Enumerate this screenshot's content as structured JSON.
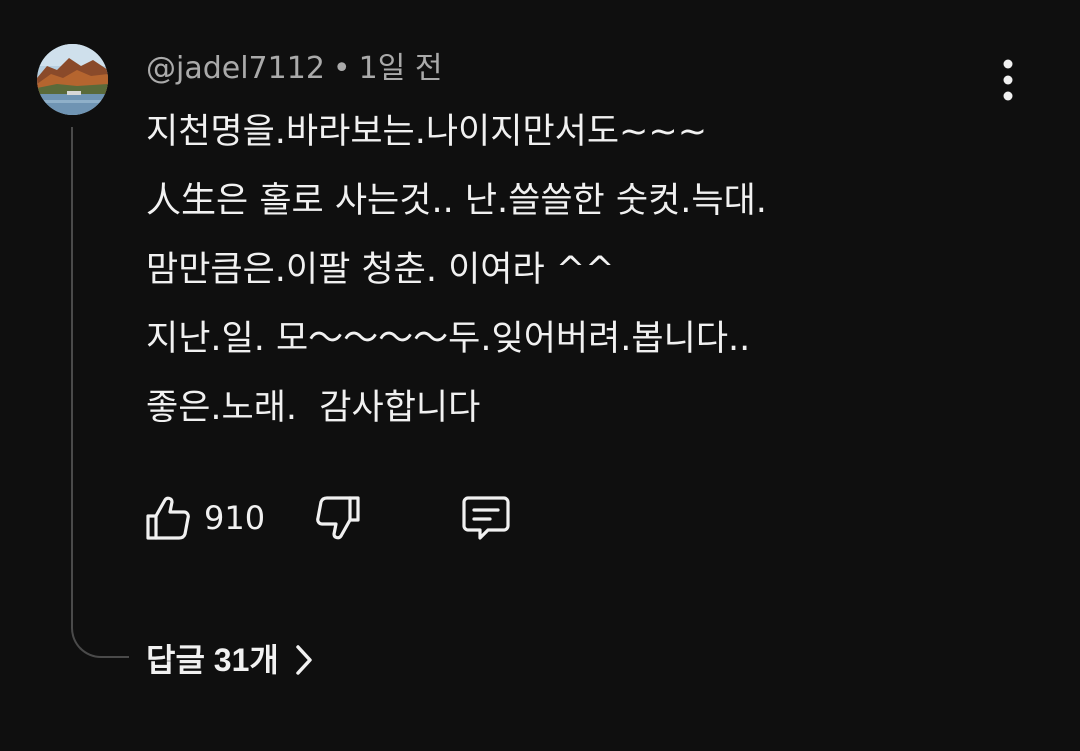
{
  "comment": {
    "author": "@jadel7112",
    "separator": "•",
    "time": "1일 전",
    "lines": [
      "지천명을.바라보는.나이지만서도~~~",
      "人生은 홀로 사는것.. 난.쓸쓸한 숫컷.늑대.",
      "맘만큼은.이팔 청춘. 이여라 ^^",
      "지난.일. 모〜〜〜〜두.잊어버려.봅니다..",
      "좋은.노래.  감사합니다"
    ],
    "like_count": "910",
    "replies_label": "답글 31개"
  },
  "icons": {
    "avatar": "landscape-avatar",
    "menu": "more-vert-icon",
    "like": "thumb-up-icon",
    "dislike": "thumb-down-icon",
    "reply": "reply-comment-icon",
    "replies_chevron": "chevron-right-icon"
  },
  "colors": {
    "background": "#0f0f0f",
    "text_primary": "#f1f1f1",
    "text_secondary": "#aaaaaa",
    "thread_line": "#4a4a4a"
  }
}
